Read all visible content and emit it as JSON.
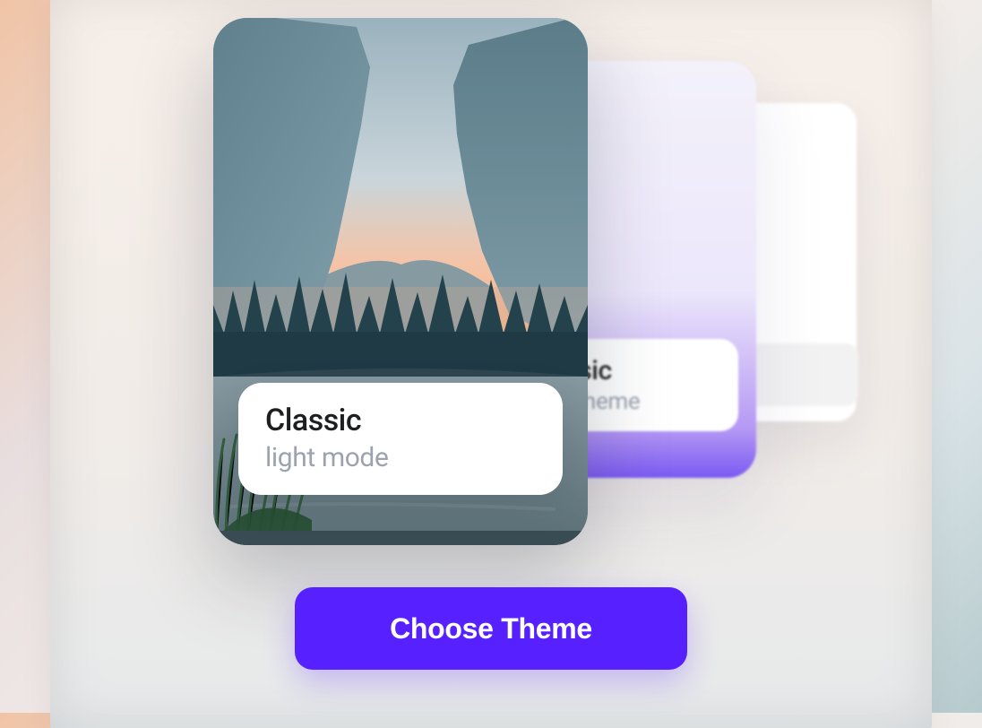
{
  "themes": [
    {
      "title": "Classic",
      "subtitle": "light mode"
    },
    {
      "title": "Classic",
      "subtitle": "light theme"
    },
    {
      "title": "",
      "subtitle": ""
    }
  ],
  "cta_label": "Choose Theme",
  "colors": {
    "accent": "#5721ff",
    "card2_gradient_top": "#f3f1fa",
    "card2_gradient_bottom": "#7a5af2"
  }
}
